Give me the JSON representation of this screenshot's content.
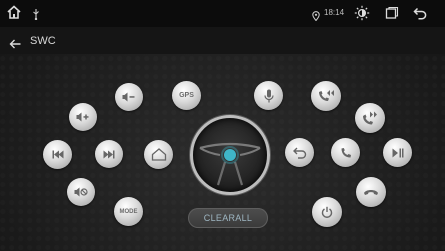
{
  "status_bar": {
    "time": "18:14"
  },
  "header": {
    "title": "SWC"
  },
  "buttons": {
    "gps_label": "GPS",
    "mode_label": "MODE",
    "clear_all_label": "CLEARALL"
  },
  "colors": {
    "accent": "#3fb6c8",
    "background": "#1e1e1e"
  }
}
